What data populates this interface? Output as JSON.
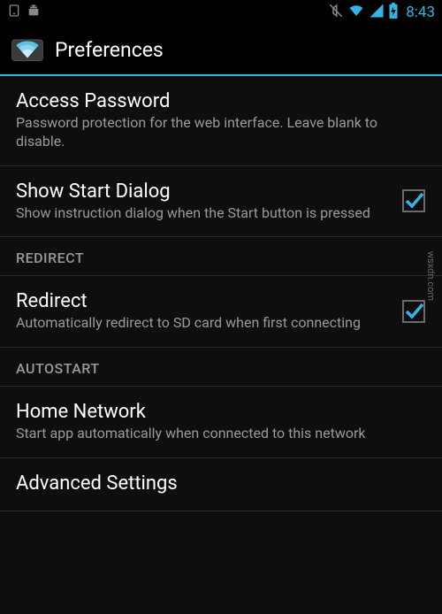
{
  "status": {
    "clock": "8:43"
  },
  "header": {
    "title": "Preferences"
  },
  "prefs": {
    "access_password": {
      "title": "Access Password",
      "summary": "Password protection for the web interface. Leave blank to disable."
    },
    "show_start_dialog": {
      "title": "Show Start Dialog",
      "summary": "Show instruction dialog when the Start button is pressed",
      "checked": true
    },
    "redirect_category": "REDIRECT",
    "redirect": {
      "title": "Redirect",
      "summary": "Automatically redirect to SD card when first connecting",
      "checked": true
    },
    "autostart_category": "AUTOSTART",
    "home_network": {
      "title": "Home Network",
      "summary": "Start app automatically when connected to this network"
    },
    "advanced": {
      "title": "Advanced Settings"
    }
  },
  "watermark": "wsxdn.com"
}
